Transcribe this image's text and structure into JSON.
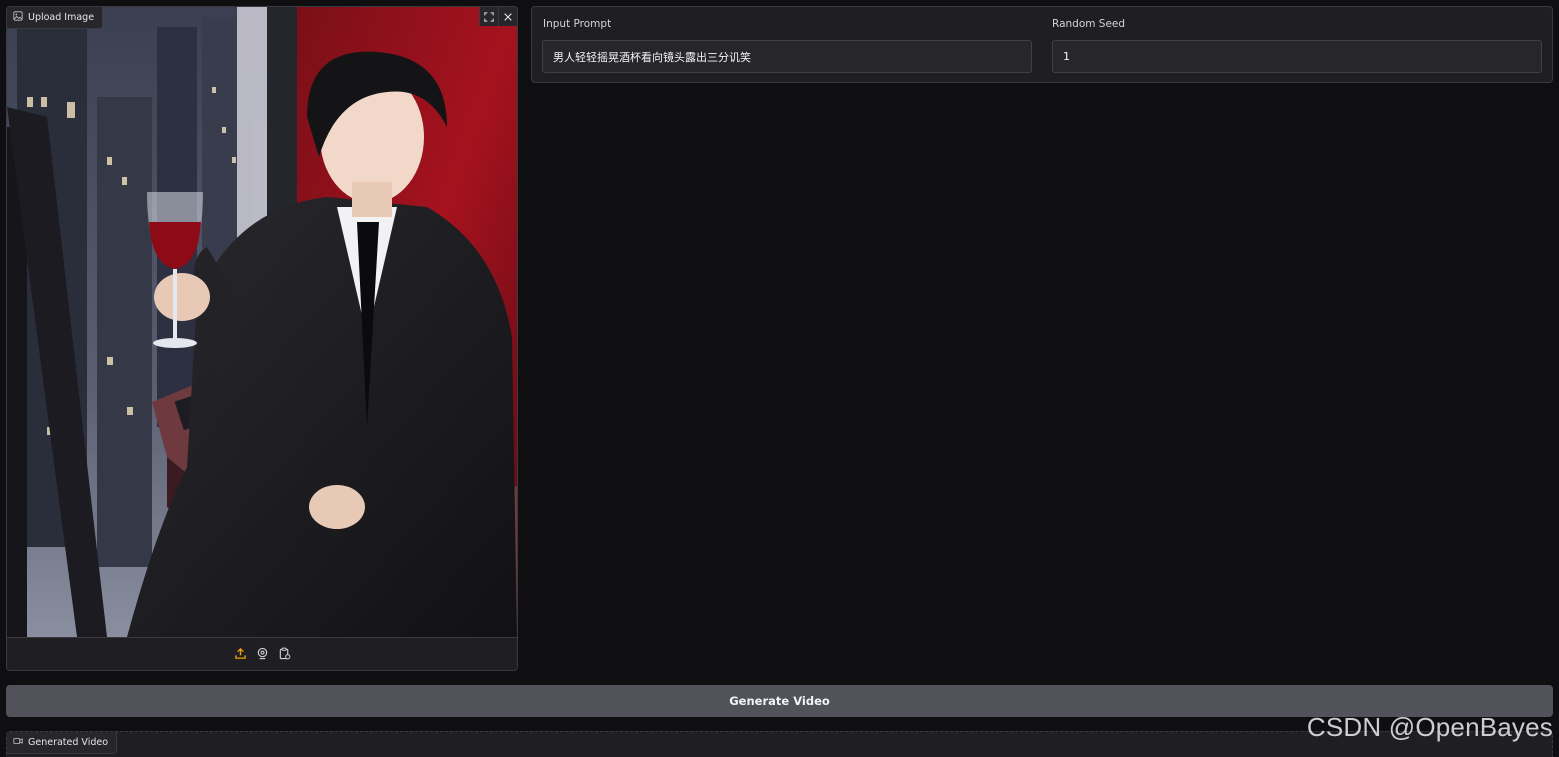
{
  "upload_panel": {
    "label": "Upload Image"
  },
  "form": {
    "prompt_label": "Input Prompt",
    "prompt_value": "男人轻轻摇晃酒杯看向镜头露出三分讥笑",
    "seed_label": "Random Seed",
    "seed_value": "1"
  },
  "generate_button": {
    "label": "Generate Video"
  },
  "video_panel": {
    "label": "Generated Video"
  },
  "watermark": "CSDN @OpenBayes",
  "icons": {
    "upload_panel_label": "image-icon",
    "fullscreen": "fullscreen-icon",
    "close": "close-icon",
    "upload_source": "upload-icon",
    "webcam_source": "webcam-icon",
    "clipboard_source": "clipboard-icon",
    "video_panel_label": "video-icon"
  },
  "colors": {
    "background": "#0f0f11",
    "panel": "#1f1f23",
    "button": "#52525b",
    "upload_icon_accent": "#f59e0b"
  }
}
